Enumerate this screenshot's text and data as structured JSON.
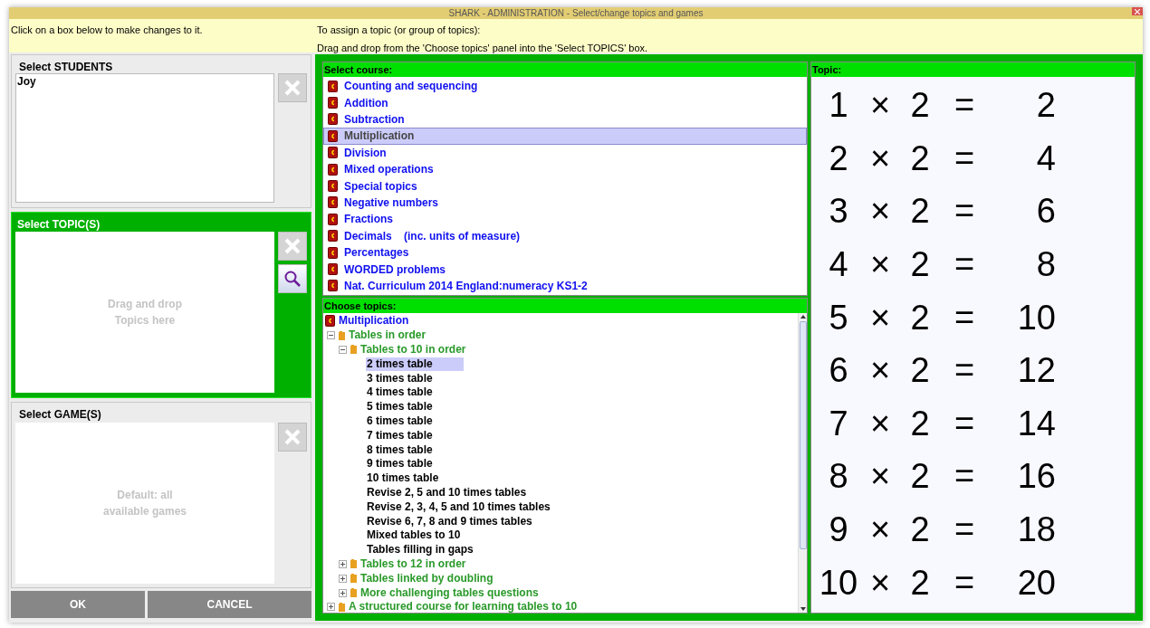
{
  "window": {
    "title": "SHARK - ADMINISTRATION - Select/change topics and games"
  },
  "instructions": {
    "left": "Click on a box below to make changes to it.",
    "right": [
      "To assign a topic (or group of topics):",
      "Drag and drop from the 'Choose topics' panel into the 'Select TOPICS' box."
    ]
  },
  "students": {
    "title": "Select STUDENTS",
    "items": [
      "Joy"
    ]
  },
  "topics_box": {
    "title": "Select TOPIC(S)",
    "placeholder": "Drag and drop Topics here"
  },
  "games_box": {
    "title": "Select GAME(S)",
    "placeholder": "Default: all available games"
  },
  "buttons": [
    "OK",
    "CANCEL"
  ],
  "courses": {
    "title": "Select course:",
    "items": [
      {
        "label": "Counting and sequencing",
        "selected": false
      },
      {
        "label": "Addition",
        "selected": false
      },
      {
        "label": "Subtraction",
        "selected": false
      },
      {
        "label": "Multiplication",
        "selected": true
      },
      {
        "label": "Division",
        "selected": false
      },
      {
        "label": "Mixed operations",
        "selected": false
      },
      {
        "label": "Special topics",
        "selected": false
      },
      {
        "label": "Negative numbers",
        "selected": false
      },
      {
        "label": "Fractions",
        "selected": false
      },
      {
        "label": "Decimals    (inc. units of measure)",
        "selected": false
      },
      {
        "label": "Percentages",
        "selected": false
      },
      {
        "label": "WORDED problems",
        "selected": false
      },
      {
        "label": "Nat. Curriculum 2014 England:numeracy KS1-2",
        "selected": false
      }
    ]
  },
  "choose_topics": {
    "title": "Choose topics:",
    "tree": [
      {
        "kind": "course",
        "label": "Multiplication",
        "children": [
          {
            "kind": "group",
            "label": "Tables in order",
            "expanded": true,
            "children": [
              {
                "kind": "group",
                "label": "Tables to 10 in order",
                "expanded": true,
                "children": [
                  {
                    "kind": "topic",
                    "label": "2 times table",
                    "selected": true
                  },
                  {
                    "kind": "topic",
                    "label": "3 times table",
                    "selected": false
                  },
                  {
                    "kind": "topic",
                    "label": "4 times table",
                    "selected": false
                  },
                  {
                    "kind": "topic",
                    "label": "5 times table",
                    "selected": false
                  },
                  {
                    "kind": "topic",
                    "label": "6 times table",
                    "selected": false
                  },
                  {
                    "kind": "topic",
                    "label": "7 times table",
                    "selected": false
                  },
                  {
                    "kind": "topic",
                    "label": "8 times table",
                    "selected": false
                  },
                  {
                    "kind": "topic",
                    "label": "9 times table",
                    "selected": false
                  },
                  {
                    "kind": "topic",
                    "label": "10 times table",
                    "selected": false
                  },
                  {
                    "kind": "topic",
                    "label": "Revise 2, 5 and 10 times tables",
                    "selected": false
                  },
                  {
                    "kind": "topic",
                    "label": "Revise 2, 3, 4, 5 and 10 times tables",
                    "selected": false
                  },
                  {
                    "kind": "topic",
                    "label": "Revise 6, 7, 8 and 9 times tables",
                    "selected": false
                  },
                  {
                    "kind": "topic",
                    "label": "Mixed tables to 10",
                    "selected": false
                  },
                  {
                    "kind": "topic",
                    "label": "Tables filling in gaps",
                    "selected": false
                  }
                ]
              },
              {
                "kind": "group",
                "label": "Tables to 12 in order",
                "expanded": false
              },
              {
                "kind": "group",
                "label": "Tables linked by doubling",
                "expanded": false
              },
              {
                "kind": "group",
                "label": "More challenging tables questions",
                "expanded": false
              }
            ]
          },
          {
            "kind": "group",
            "label": "A structured course for learning tables to 10",
            "expanded": false
          }
        ]
      }
    ]
  },
  "topic_preview": {
    "title": "Topic:",
    "lines": [
      [
        "1",
        "×",
        "2",
        "=",
        "2"
      ],
      [
        "2",
        "×",
        "2",
        "=",
        "4"
      ],
      [
        "3",
        "×",
        "2",
        "=",
        "6"
      ],
      [
        "4",
        "×",
        "2",
        "=",
        "8"
      ],
      [
        "5",
        "×",
        "2",
        "=",
        "10"
      ],
      [
        "6",
        "×",
        "2",
        "=",
        "12"
      ],
      [
        "7",
        "×",
        "2",
        "=",
        "14"
      ],
      [
        "8",
        "×",
        "2",
        "=",
        "16"
      ],
      [
        "9",
        "×",
        "2",
        "=",
        "18"
      ],
      [
        "10",
        "×",
        "2",
        "=",
        "20"
      ]
    ]
  }
}
